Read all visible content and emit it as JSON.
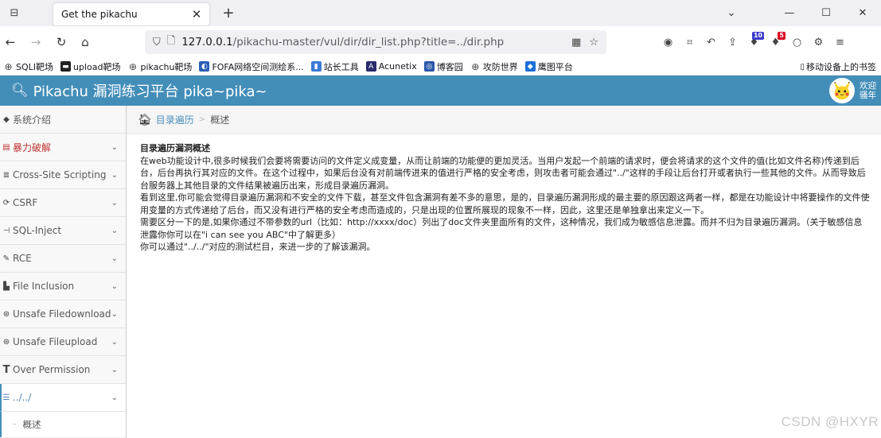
{
  "browser": {
    "tab_title": "Get the pikachu",
    "url_host": "127.0.0.1",
    "url_path": "/pikachu-master/vul/dir/dir_list.php?title=../dir.php",
    "extension_badges": [
      "10",
      "5"
    ],
    "bookmarks": [
      {
        "label": "SQLI靶场",
        "icon": "globe-icon",
        "color": "#444"
      },
      {
        "label": "upload靶场",
        "icon": "folder-icon",
        "color": "#222"
      },
      {
        "label": "pikachu靶场",
        "icon": "globe-icon",
        "color": "#444"
      },
      {
        "label": "FOFA网络空间测绘系...",
        "icon": "fofa-icon",
        "color": "#2b5fb3"
      },
      {
        "label": "站长工具",
        "icon": "chart-icon",
        "color": "#3a7bd5"
      },
      {
        "label": "Acunetix",
        "icon": "acunetix-icon",
        "color": "#2a2a6e"
      },
      {
        "label": "博客园",
        "icon": "blog-icon",
        "color": "#2a57a8"
      },
      {
        "label": "攻防世界",
        "icon": "globe-icon",
        "color": "#444"
      },
      {
        "label": "鹰图平台",
        "icon": "eagle-icon",
        "color": "#1c6fd8"
      }
    ],
    "mobile_bookmarks": "移动设备上的书签"
  },
  "app": {
    "brand": "Pikachu 漏洞练习平台 pika~pika~",
    "welcome_line1": "欢迎",
    "welcome_line2": "骚年"
  },
  "sidebar": {
    "items": [
      {
        "label": "系统介绍",
        "icon": "tags-icon",
        "state": "normal",
        "chevron": false
      },
      {
        "label": "暴力破解",
        "icon": "list-icon",
        "state": "red",
        "chevron": true
      },
      {
        "label": "Cross-Site Scripting",
        "icon": "xss-icon",
        "state": "normal",
        "chevron": true
      },
      {
        "label": "CSRF",
        "icon": "refresh-icon",
        "state": "normal",
        "chevron": true
      },
      {
        "label": "SQL-Inject",
        "icon": "inject-icon",
        "state": "normal",
        "chevron": true
      },
      {
        "label": "RCE",
        "icon": "pen-icon",
        "state": "normal",
        "chevron": true
      },
      {
        "label": "File Inclusion",
        "icon": "file-icon",
        "state": "normal",
        "chevron": true
      },
      {
        "label": "Unsafe Filedownload",
        "icon": "download-icon",
        "state": "normal",
        "chevron": true
      },
      {
        "label": "Unsafe Fileupload",
        "icon": "upload-icon",
        "state": "normal",
        "chevron": true
      },
      {
        "label": "Over Permission",
        "icon": "t-icon",
        "state": "normal",
        "chevron": true
      },
      {
        "label": "../../",
        "icon": "menu-icon",
        "state": "open",
        "chevron": true
      }
    ],
    "sub_item": "概述"
  },
  "breadcrumb": {
    "link": "目录遍历",
    "current": "概述"
  },
  "content": {
    "title": "目录遍历漏洞概述",
    "p1": "在web功能设计中,很多时候我们会要将需要访问的文件定义成变量，从而让前端的功能便的更加灵活。当用户发起一个前端的请求时，便会将请求的这个文件的值(比如文件名称)传递到后台，后台再执行其对应的文件。在这个过程中，如果后台没有对前端传进来的值进行严格的安全考虑，则攻击者可能会通过\"../\"这样的手段让后台打开或者执行一些其他的文件。从而导致后台服务器上其他目录的文件结果被遍历出来，形成目录遍历漏洞。",
    "p2": "看到这里,你可能会觉得目录遍历漏洞和不安全的文件下载，甚至文件包含漏洞有差不多的意思，是的，目录遍历漏洞形成的最主要的原因跟这两者一样，都是在功能设计中将要操作的文件使用变量的方式传递给了后台，而又没有进行严格的安全考虑而造成的，只是出现的位置所展现的现象不一样，因此，这里还是单独拿出来定义一下。",
    "p3": "需要区分一下的是,如果你通过不带参数的url（比如：http://xxxx/doc）列出了doc文件夹里面所有的文件，这种情况，我们成为敏感信息泄露。而并不归为目录遍历漏洞。（关于敏感信息泄露你你可以在\"i can see you ABC\"中了解更多）",
    "p4": "你可以通过\"../../\"对应的测试栏目，来进一步的了解该漏洞。"
  },
  "watermark": "CSDN @HXYR"
}
